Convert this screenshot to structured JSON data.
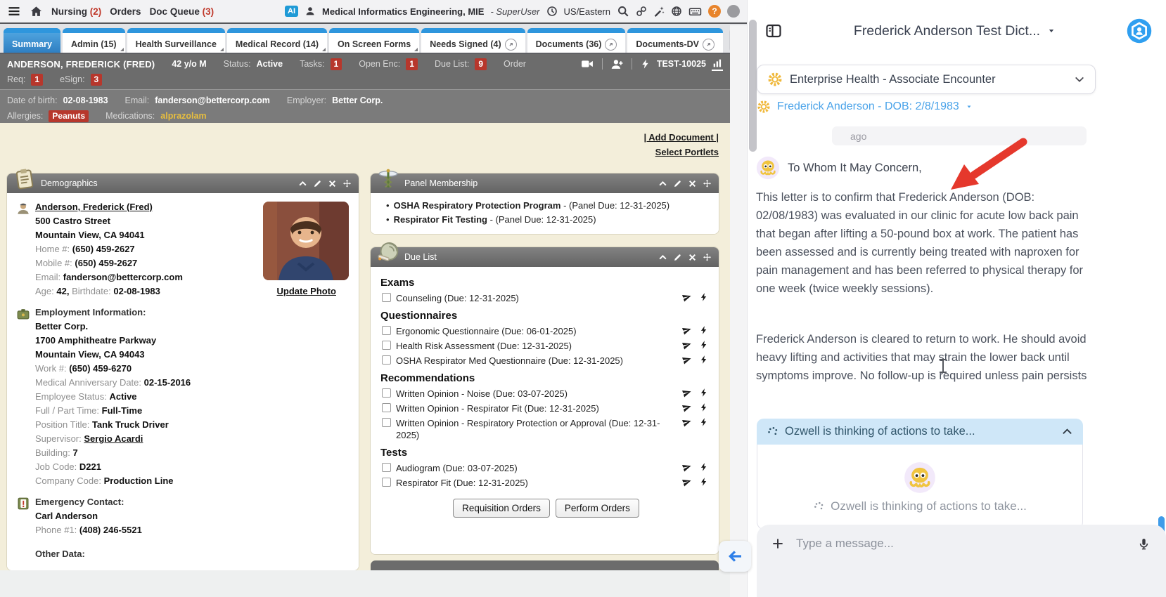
{
  "topnav": {
    "menu_items": [
      {
        "label": "Nursing",
        "count": "(2)"
      },
      {
        "label": "Orders",
        "count": ""
      },
      {
        "label": "Doc Queue",
        "count": "(3)"
      }
    ],
    "ai_badge": "AI",
    "org_name": "Medical Informatics Engineering, MIE",
    "user_role": "- SuperUser",
    "timezone": "US/Eastern",
    "help_glyph": "?"
  },
  "tabs": [
    {
      "label": "Summary"
    },
    {
      "label": "Admin (15)"
    },
    {
      "label": "Health Surveillance"
    },
    {
      "label": "Medical Record (14)"
    },
    {
      "label": "On Screen Forms"
    },
    {
      "label": "Needs Signed (4)"
    },
    {
      "label": "Documents (36)"
    },
    {
      "label": "Documents-DV"
    }
  ],
  "patient_bar": {
    "name": "ANDERSON, FREDERICK (FRED)",
    "age_sex": "42 y/o M",
    "status_label": "Status:",
    "status_value": "Active",
    "tasks_label": "Tasks:",
    "tasks_count": "1",
    "open_enc_label": "Open Enc:",
    "open_enc_count": "1",
    "due_list_label": "Due List:",
    "due_list_count": "9",
    "order_label": "Order",
    "chart_id": "TEST-10025",
    "req_label": "Req:",
    "req_count": "1",
    "esign_label": "eSign:",
    "esign_count": "3"
  },
  "info_bar": {
    "dob_label": "Date of birth:",
    "dob": "02-08-1983",
    "email_label": "Email:",
    "email": "fanderson@bettercorp.com",
    "employer_label": "Employer:",
    "employer": "Better Corp.",
    "allergies_label": "Allergies:",
    "allergy": "Peanuts",
    "medications_label": "Medications:",
    "medication": "alprazolam"
  },
  "actions": {
    "add_document": "| Add Document |",
    "select_portlets": "Select Portlets"
  },
  "portlets": {
    "demographics": {
      "title": "Demographics",
      "name": "Anderson, Frederick (Fred)",
      "address1": "500 Castro Street",
      "address2": "Mountain View, CA 94041",
      "home_label": "Home #:",
      "home": "(650) 459-2627",
      "mobile_label": "Mobile #:",
      "mobile": "(650) 459-2627",
      "email_label": "Email:",
      "email": "fanderson@bettercorp.com",
      "age_label": "Age:",
      "age": "42,",
      "birth_label": "Birthdate:",
      "birthdate": "02-08-1983",
      "update_photo": "Update Photo",
      "employment_title": "Employment Information:",
      "employer": "Better Corp.",
      "emp_address1": "1700 Amphitheatre Parkway",
      "emp_address2": "Mountain View, CA 94043",
      "work_label": "Work #:",
      "work": "(650) 459-6270",
      "anniversary_label": "Medical Anniversary Date:",
      "anniversary": "02-15-2016",
      "emp_status_label": "Employee Status:",
      "emp_status": "Active",
      "fpt_label": "Full / Part Time:",
      "fpt": "Full-Time",
      "position_label": "Position Title:",
      "position": "Tank Truck Driver",
      "supervisor_label": "Supervisor:",
      "supervisor": "Sergio Acardi",
      "building_label": "Building:",
      "building": "7",
      "jobcode_label": "Job Code:",
      "jobcode": "D221",
      "companycode_label": "Company Code:",
      "companycode": "Production Line",
      "emergency_title": "Emergency Contact:",
      "emergency_name": "Carl Anderson",
      "phone1_label": "Phone #1:",
      "phone1": "(408) 246-5521",
      "other_title": "Other Data:"
    },
    "panel_membership": {
      "title": "Panel Membership",
      "items": [
        {
          "name": "OSHA Respiratory Protection Program",
          "due": " - (Panel Due: 12-31-2025)"
        },
        {
          "name": "Respirator Fit Testing",
          "due": " - (Panel Due: 12-31-2025)"
        }
      ]
    },
    "due_list": {
      "title": "Due List",
      "sections": [
        {
          "heading": "Exams",
          "items": [
            "Counseling (Due: 12-31-2025)"
          ]
        },
        {
          "heading": "Questionnaires",
          "items": [
            "Ergonomic Questionnaire (Due: 06-01-2025)",
            "Health Risk Assessment (Due: 12-31-2025)",
            "OSHA Respirator Med Questionnaire (Due: 12-31-2025)"
          ]
        },
        {
          "heading": "Recommendations",
          "items": [
            "Written Opinion - Noise (Due: 03-07-2025)",
            "Written Opinion - Respirator Fit (Due: 12-31-2025)",
            "Written Opinion - Respiratory Protection or Approval (Due: 12-31-2025)"
          ]
        },
        {
          "heading": "Tests",
          "items": [
            "Audiogram (Due: 03-07-2025)",
            "Respirator Fit (Due: 12-31-2025)"
          ]
        }
      ],
      "buttons": [
        "Requisition Orders",
        "Perform Orders"
      ]
    }
  },
  "assistant": {
    "title": "Frederick Anderson Test Dict...",
    "encounter": "Enterprise Health - Associate Encounter",
    "patient_link": "Frederick Anderson - DOB: 2/8/1983",
    "ago": "ago",
    "greeting": "To Whom It May Concern,",
    "paragraph1": "This letter is to confirm that Frederick Anderson (DOB: 02/08/1983) was evaluated in our clinic for acute low back pain that began after lifting a 50-pound box at work. The patient has been assessed and is currently being treated with naproxen for pain management and has been referred to physical therapy for one week (twice weekly sessions).",
    "paragraph2": "Frederick Anderson is cleared to return to work. He should avoid heavy lifting and activities that may strain the lower back until symptoms improve. No follow-up is required unless pain persists",
    "thinking_banner": "Ozwell is thinking of actions to take...",
    "thinking_card": "Ozwell is thinking of actions to take...",
    "input_placeholder": "Type a message..."
  },
  "icons": {
    "hamburger": "menu",
    "home": "house",
    "user": "person",
    "clock": "clock",
    "search": "magnifier",
    "link": "chain",
    "wand": "magic-wand",
    "globe": "globe",
    "keyboard": "keyboard",
    "help": "?",
    "video": "camera",
    "user_add": "person-plus",
    "bolt": "lightning",
    "chart": "bar-chart",
    "send": "paper-plane",
    "collapse": "caret-up",
    "edit": "pencil",
    "close": "x",
    "move": "four-arrows",
    "external": "arrow-up-right-circle",
    "gears": "cogs",
    "sun": "yellow-gear-ring",
    "mic": "microphone",
    "plus": "+",
    "back": "left-arrow",
    "avatar": "octopus"
  },
  "colors": {
    "tab_blue": "#2e96dd",
    "badge_red": "#b7372c",
    "content_cream": "#f3eeda",
    "bar_gray": "#6c6c6c",
    "thinking_blue": "#cfe7f8",
    "link_blue": "#4aa3e9",
    "logo_blue": "#2f9ff0",
    "arrow_red": "#e5382c",
    "medication_yellow": "#e6bd3f"
  }
}
